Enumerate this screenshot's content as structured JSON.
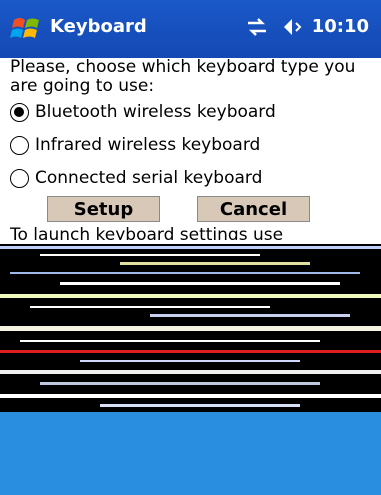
{
  "titlebar": {
    "title": "Keyboard",
    "time": "10:10",
    "icons": [
      "windows-start-icon",
      "connectivity-icon",
      "volume-icon"
    ]
  },
  "prompt": "Please, choose which keyboard type you are going to use:",
  "options": [
    {
      "label": "Bluetooth wireless keyboard",
      "checked": true
    },
    {
      "label": "Infrared wireless keyboard",
      "checked": false
    },
    {
      "label": "Connected serial keyboard",
      "checked": false
    }
  ],
  "buttons": {
    "setup": "Setup",
    "cancel": "Cancel"
  },
  "partial_text": "To launch keyboard settings use",
  "colors": {
    "titlebar": "#1449b4",
    "button": "#d8c8b8",
    "bottom_panel": "#2a8ee0"
  }
}
